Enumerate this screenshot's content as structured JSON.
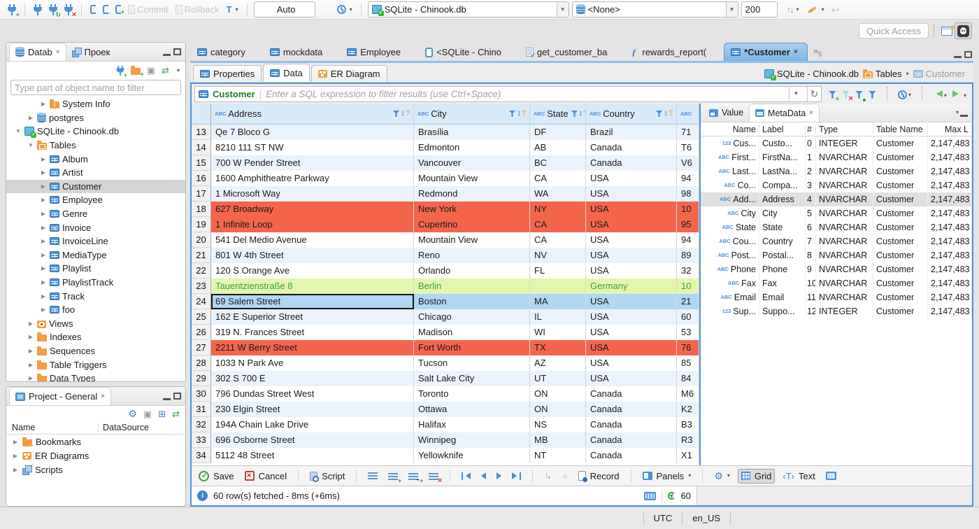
{
  "topbar": {
    "commit": "Commit",
    "rollback": "Rollback",
    "auto": "Auto",
    "connection": "SQLite - Chinook.db",
    "schema": "<None>",
    "fetch_size": "200"
  },
  "quick_access": "Quick Access",
  "navigator": {
    "tab_db": "Datab",
    "tab_proj": "Проек",
    "filter_placeholder": "Type part of object name to filter",
    "tree": [
      {
        "label": "System Info",
        "icon": "ic-folder ic-info",
        "ind": "ind3",
        "arrow": "▶",
        "cls": ""
      },
      {
        "label": "postgres",
        "icon": "ic-db",
        "ind": "ind2",
        "arrow": "▶",
        "cls": ""
      },
      {
        "label": "SQLite - Chinook.db",
        "icon": "ic-dbfile",
        "ind": "ind1",
        "arrow": "▼",
        "cls": ""
      },
      {
        "label": "Tables",
        "icon": "ic-folder ic-ftable",
        "ind": "ind2",
        "arrow": "▼",
        "cls": ""
      },
      {
        "label": "Album",
        "icon": "ic-table",
        "ind": "ind3",
        "arrow": "▶",
        "cls": ""
      },
      {
        "label": "Artist",
        "icon": "ic-table",
        "ind": "ind3",
        "arrow": "▶",
        "cls": ""
      },
      {
        "label": "Customer",
        "icon": "ic-table",
        "ind": "ind3",
        "arrow": "▶",
        "cls": "sel"
      },
      {
        "label": "Employee",
        "icon": "ic-table",
        "ind": "ind3",
        "arrow": "▶",
        "cls": ""
      },
      {
        "label": "Genre",
        "icon": "ic-table",
        "ind": "ind3",
        "arrow": "▶",
        "cls": ""
      },
      {
        "label": "Invoice",
        "icon": "ic-table",
        "ind": "ind3",
        "arrow": "▶",
        "cls": ""
      },
      {
        "label": "InvoiceLine",
        "icon": "ic-table",
        "ind": "ind3",
        "arrow": "▶",
        "cls": ""
      },
      {
        "label": "MediaType",
        "icon": "ic-table",
        "ind": "ind3",
        "arrow": "▶",
        "cls": ""
      },
      {
        "label": "Playlist",
        "icon": "ic-table",
        "ind": "ind3",
        "arrow": "▶",
        "cls": ""
      },
      {
        "label": "PlaylistTrack",
        "icon": "ic-table",
        "ind": "ind3",
        "arrow": "▶",
        "cls": ""
      },
      {
        "label": "Track",
        "icon": "ic-table",
        "ind": "ind3",
        "arrow": "▶",
        "cls": ""
      },
      {
        "label": "foo",
        "icon": "ic-table",
        "ind": "ind3",
        "arrow": "▶",
        "cls": ""
      },
      {
        "label": "Views",
        "icon": "ic-eye",
        "ind": "ind2",
        "arrow": "▶",
        "cls": ""
      },
      {
        "label": "Indexes",
        "icon": "ic-folder",
        "ind": "ind2",
        "arrow": "▶",
        "cls": ""
      },
      {
        "label": "Sequences",
        "icon": "ic-folder",
        "ind": "ind2",
        "arrow": "▶",
        "cls": ""
      },
      {
        "label": "Table Triggers",
        "icon": "ic-folder",
        "ind": "ind2",
        "arrow": "▶",
        "cls": ""
      },
      {
        "label": "Data Types",
        "icon": "ic-folder",
        "ind": "ind2",
        "arrow": "▶",
        "cls": ""
      }
    ]
  },
  "project": {
    "title": "Project - General",
    "col_name": "Name",
    "col_ds": "DataSource",
    "items": [
      {
        "label": "Bookmarks",
        "icon": "ic-folder ic-star",
        "arrow": "▶"
      },
      {
        "label": "ER Diagrams",
        "icon": "ic-erd",
        "arrow": "▶"
      },
      {
        "label": "Scripts",
        "icon": "ic-scripts",
        "arrow": "▶"
      }
    ]
  },
  "editor_tabs": [
    {
      "label": "category",
      "icon": "ic-table",
      "cls": "",
      "close": ""
    },
    {
      "label": "mockdata",
      "icon": "ic-table",
      "cls": "",
      "close": ""
    },
    {
      "label": "Employee",
      "icon": "ic-table",
      "cls": "",
      "close": ""
    },
    {
      "label": "<SQLite - Chino",
      "icon": "ic-sql",
      "cls": "",
      "close": ""
    },
    {
      "label": "get_customer_ba",
      "icon": "ic-sqlcheck",
      "cls": "",
      "close": ""
    },
    {
      "label": "rewards_report(",
      "icon": "ic-fn",
      "cls": "",
      "close": ""
    },
    {
      "label": "*Customer",
      "icon": "ic-table",
      "cls": "active",
      "close": "×"
    }
  ],
  "tab_overflow": {
    "chev": "»",
    "count": "5"
  },
  "subtabs": [
    {
      "label": "Properties",
      "icon": "ic-table",
      "cls": ""
    },
    {
      "label": "Data",
      "icon": "ic-table",
      "cls": "active"
    },
    {
      "label": "ER Diagram",
      "icon": "ic-erd",
      "cls": ""
    }
  ],
  "breadcrumb": {
    "db": "SQLite - Chinook.db",
    "tables": "Tables",
    "table": "Customer"
  },
  "filterbar": {
    "table": "Customer",
    "placeholder": "Enter a SQL expression to filter results (use Ctrl+Space)"
  },
  "grid": {
    "columns": [
      {
        "label": "Address",
        "cls": "c-addr"
      },
      {
        "label": "City",
        "cls": "c-city"
      },
      {
        "label": "State",
        "cls": "c-state"
      },
      {
        "label": "Country",
        "cls": "c-ctry"
      }
    ],
    "rows": [
      {
        "n": "13",
        "address": "Qe 7 Bloco G",
        "city": "Brasília",
        "state": "DF",
        "country": "Brazil",
        "postal": "71",
        "cls": "alt",
        "focus": ""
      },
      {
        "n": "14",
        "address": "8210 111 ST NW",
        "city": "Edmonton",
        "state": "AB",
        "country": "Canada",
        "postal": "T6",
        "cls": "",
        "focus": ""
      },
      {
        "n": "15",
        "address": "700 W Pender Street",
        "city": "Vancouver",
        "state": "BC",
        "country": "Canada",
        "postal": "V6",
        "cls": "alt",
        "focus": ""
      },
      {
        "n": "16",
        "address": "1600 Amphitheatre Parkway",
        "city": "Mountain View",
        "state": "CA",
        "country": "USA",
        "postal": "94",
        "cls": "",
        "focus": ""
      },
      {
        "n": "17",
        "address": "1 Microsoft Way",
        "city": "Redmond",
        "state": "WA",
        "country": "USA",
        "postal": "98",
        "cls": "alt",
        "focus": ""
      },
      {
        "n": "18",
        "address": "627 Broadway",
        "city": "New York",
        "state": "NY",
        "country": "USA",
        "postal": "10",
        "cls": "red",
        "focus": ""
      },
      {
        "n": "19",
        "address": "1 Infinite Loop",
        "city": "Cupertino",
        "state": "CA",
        "country": "USA",
        "postal": "95",
        "cls": "red",
        "focus": ""
      },
      {
        "n": "20",
        "address": "541 Del Medio Avenue",
        "city": "Mountain View",
        "state": "CA",
        "country": "USA",
        "postal": "94",
        "cls": "",
        "focus": ""
      },
      {
        "n": "21",
        "address": "801 W 4th Street",
        "city": "Reno",
        "state": "NV",
        "country": "USA",
        "postal": "89",
        "cls": "alt",
        "focus": ""
      },
      {
        "n": "22",
        "address": "120 S Orange Ave",
        "city": "Orlando",
        "state": "FL",
        "country": "USA",
        "postal": "32",
        "cls": "",
        "focus": ""
      },
      {
        "n": "23",
        "address": "Tauentzienstraße 8",
        "city": "Berlin",
        "state": "",
        "country": "Germany",
        "postal": "10",
        "cls": "green",
        "focus": ""
      },
      {
        "n": "24",
        "address": "69 Salem Street",
        "city": "Boston",
        "state": "MA",
        "country": "USA",
        "postal": "21",
        "cls": "sel",
        "focus": "focus"
      },
      {
        "n": "25",
        "address": "162 E Superior Street",
        "city": "Chicago",
        "state": "IL",
        "country": "USA",
        "postal": "60",
        "cls": "alt",
        "focus": ""
      },
      {
        "n": "26",
        "address": "319 N. Frances Street",
        "city": "Madison",
        "state": "WI",
        "country": "USA",
        "postal": "53",
        "cls": "",
        "focus": ""
      },
      {
        "n": "27",
        "address": "2211 W Berry Street",
        "city": "Fort Worth",
        "state": "TX",
        "country": "USA",
        "postal": "76",
        "cls": "red",
        "focus": ""
      },
      {
        "n": "28",
        "address": "1033 N Park Ave",
        "city": "Tucson",
        "state": "AZ",
        "country": "USA",
        "postal": "85",
        "cls": "",
        "focus": ""
      },
      {
        "n": "29",
        "address": "302 S 700 E",
        "city": "Salt Lake City",
        "state": "UT",
        "country": "USA",
        "postal": "84",
        "cls": "alt",
        "focus": ""
      },
      {
        "n": "30",
        "address": "796 Dundas Street West",
        "city": "Toronto",
        "state": "ON",
        "country": "Canada",
        "postal": "M6",
        "cls": "",
        "focus": ""
      },
      {
        "n": "31",
        "address": "230 Elgin Street",
        "city": "Ottawa",
        "state": "ON",
        "country": "Canada",
        "postal": "K2",
        "cls": "alt",
        "focus": ""
      },
      {
        "n": "32",
        "address": "194A Chain Lake Drive",
        "city": "Halifax",
        "state": "NS",
        "country": "Canada",
        "postal": "B3",
        "cls": "",
        "focus": ""
      },
      {
        "n": "33",
        "address": "696 Osborne Street",
        "city": "Winnipeg",
        "state": "MB",
        "country": "Canada",
        "postal": "R3",
        "cls": "alt",
        "focus": ""
      },
      {
        "n": "34",
        "address": "5112 48 Street",
        "city": "Yellowknife",
        "state": "NT",
        "country": "Canada",
        "postal": "X1",
        "cls": "",
        "focus": ""
      }
    ]
  },
  "metadata": {
    "tab_value": "Value",
    "tab_meta": "MetaData",
    "columns": {
      "name": "Name",
      "label": "Label",
      "num": "#",
      "type": "Type",
      "table": "Table Name",
      "max": "Max L"
    },
    "rows": [
      {
        "icon": "123",
        "name": "Cus...",
        "label": "Custo...",
        "num": "0",
        "type": "INTEGER",
        "table": "Customer",
        "max": "2,147,483",
        "cls": ""
      },
      {
        "icon": "ABC",
        "name": "First...",
        "label": "FirstNa...",
        "num": "1",
        "type": "NVARCHAR",
        "table": "Customer",
        "max": "2,147,483",
        "cls": ""
      },
      {
        "icon": "ABC",
        "name": "Last...",
        "label": "LastNa...",
        "num": "2",
        "type": "NVARCHAR",
        "table": "Customer",
        "max": "2,147,483",
        "cls": ""
      },
      {
        "icon": "ABC",
        "name": "Co...",
        "label": "Compa...",
        "num": "3",
        "type": "NVARCHAR",
        "table": "Customer",
        "max": "2,147,483",
        "cls": ""
      },
      {
        "icon": "ABC",
        "name": "Add...",
        "label": "Address",
        "num": "4",
        "type": "NVARCHAR",
        "table": "Customer",
        "max": "2,147,483",
        "cls": "sel"
      },
      {
        "icon": "ABC",
        "name": "City",
        "label": "City",
        "num": "5",
        "type": "NVARCHAR",
        "table": "Customer",
        "max": "2,147,483",
        "cls": ""
      },
      {
        "icon": "ABC",
        "name": "State",
        "label": "State",
        "num": "6",
        "type": "NVARCHAR",
        "table": "Customer",
        "max": "2,147,483",
        "cls": ""
      },
      {
        "icon": "ABC",
        "name": "Cou...",
        "label": "Country",
        "num": "7",
        "type": "NVARCHAR",
        "table": "Customer",
        "max": "2,147,483",
        "cls": ""
      },
      {
        "icon": "ABC",
        "name": "Post...",
        "label": "Postal...",
        "num": "8",
        "type": "NVARCHAR",
        "table": "Customer",
        "max": "2,147,483",
        "cls": ""
      },
      {
        "icon": "ABC",
        "name": "Phone",
        "label": "Phone",
        "num": "9",
        "type": "NVARCHAR",
        "table": "Customer",
        "max": "2,147,483",
        "cls": ""
      },
      {
        "icon": "ABC",
        "name": "Fax",
        "label": "Fax",
        "num": "10",
        "type": "NVARCHAR",
        "table": "Customer",
        "max": "2,147,483",
        "cls": ""
      },
      {
        "icon": "ABC",
        "name": "Email",
        "label": "Email",
        "num": "11",
        "type": "NVARCHAR",
        "table": "Customer",
        "max": "2,147,483",
        "cls": ""
      },
      {
        "icon": "123",
        "name": "Sup...",
        "label": "Suppo...",
        "num": "12",
        "type": "INTEGER",
        "table": "Customer",
        "max": "2,147,483",
        "cls": ""
      }
    ]
  },
  "bottombar": {
    "save": "Save",
    "cancel": "Cancel",
    "script": "Script",
    "record": "Record",
    "panels": "Panels",
    "grid": "Grid",
    "text": "Text"
  },
  "status": {
    "fetched": "60 row(s) fetched - 8ms (+6ms)",
    "autorefresh": "60"
  },
  "statusbar": {
    "tz": "UTC",
    "locale": "en_US"
  }
}
